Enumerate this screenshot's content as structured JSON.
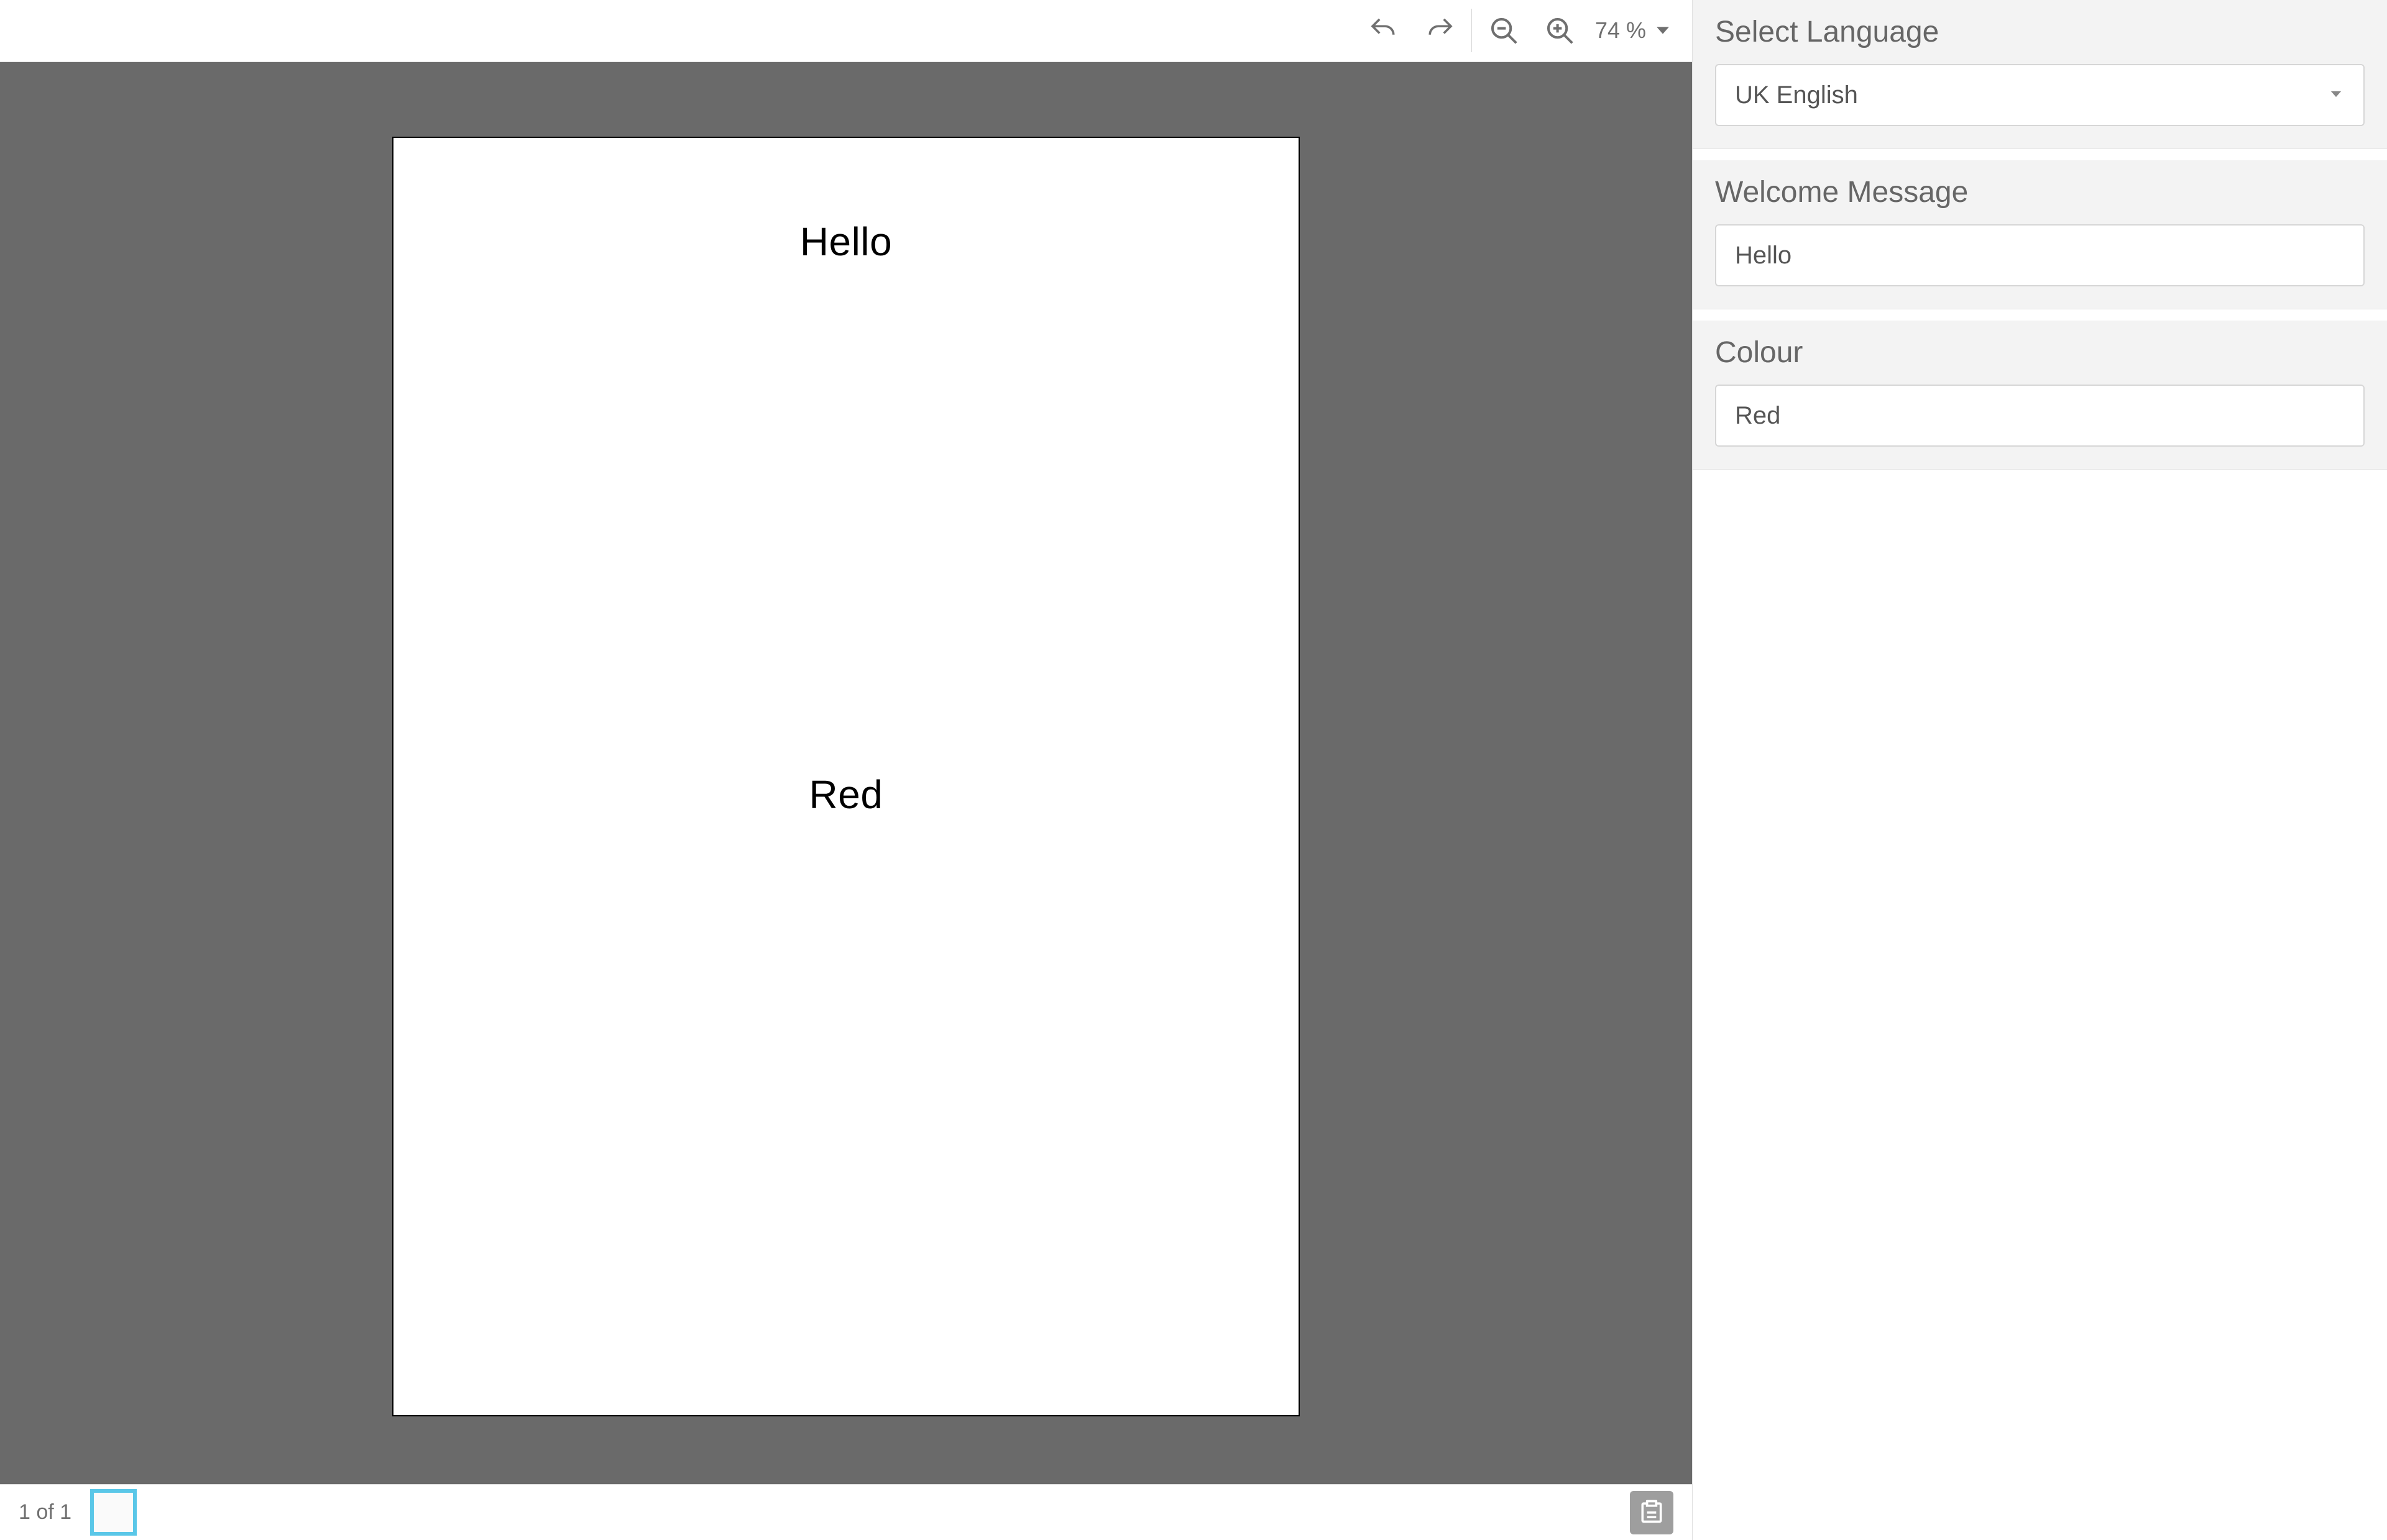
{
  "toolbar": {
    "zoom_value": "74",
    "zoom_unit": "%"
  },
  "document": {
    "line1": "Hello",
    "line2": "Red"
  },
  "statusbar": {
    "page_indicator": "1 of 1"
  },
  "sidebar": {
    "language": {
      "title": "Select Language",
      "value": "UK English"
    },
    "welcome": {
      "title": "Welcome Message",
      "value": "Hello"
    },
    "colour": {
      "title": "Colour",
      "value": "Red"
    }
  }
}
